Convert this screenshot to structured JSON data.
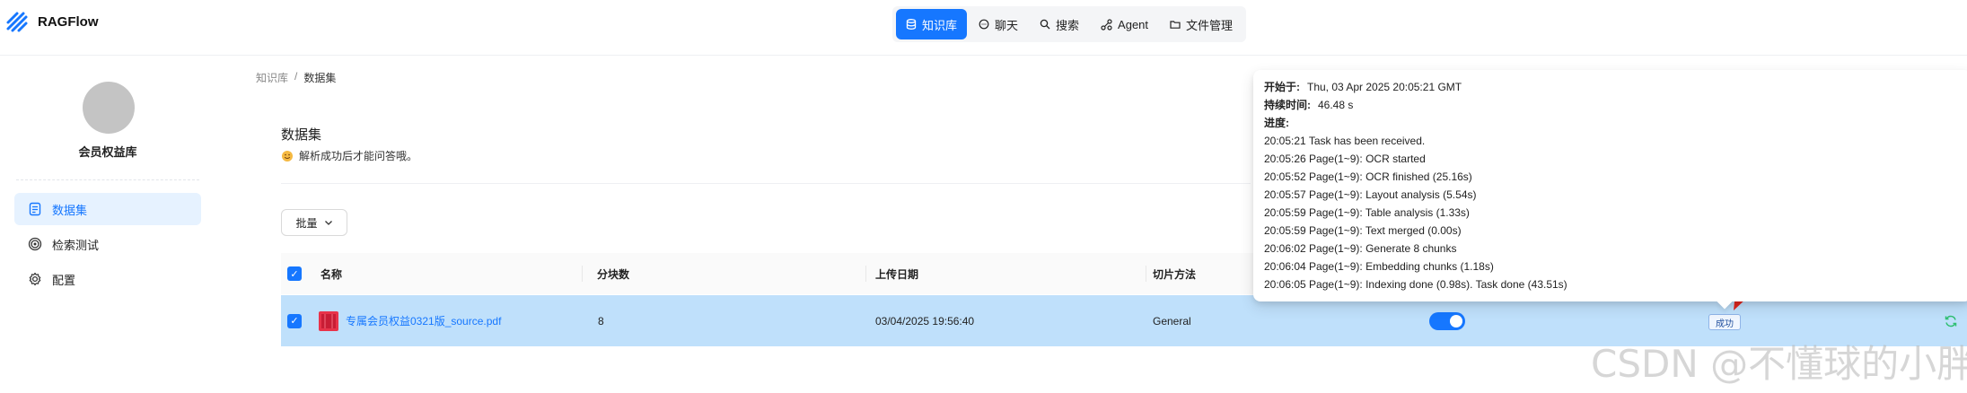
{
  "app": {
    "name": "RAGFlow"
  },
  "nav": [
    {
      "label": "知识库",
      "icon": "database-icon",
      "active": true
    },
    {
      "label": "聊天",
      "icon": "chat-icon",
      "active": false
    },
    {
      "label": "搜索",
      "icon": "search-icon",
      "active": false
    },
    {
      "label": "Agent",
      "icon": "agent-icon",
      "active": false
    },
    {
      "label": "文件管理",
      "icon": "folder-icon",
      "active": false
    }
  ],
  "sidebar": {
    "kb_name": "会员权益库",
    "items": [
      {
        "label": "数据集",
        "icon": "document-icon",
        "active": true
      },
      {
        "label": "检索测试",
        "icon": "target-icon",
        "active": false
      },
      {
        "label": "配置",
        "icon": "gear-icon",
        "active": false
      }
    ]
  },
  "breadcrumb": {
    "root": "知识库",
    "separator": "/",
    "current": "数据集"
  },
  "main": {
    "title": "数据集",
    "description": "解析成功后才能问答哦。",
    "bulk_button": "批量"
  },
  "table": {
    "headers": {
      "name": "名称",
      "chunks": "分块数",
      "upload_date": "上传日期",
      "chunk_method": "切片方法"
    },
    "rows": [
      {
        "name": "专属会员权益0321版_source.pdf",
        "chunks": "8",
        "upload_date": "03/04/2025 19:56:40",
        "chunk_method": "General",
        "enabled": true,
        "status": "成功"
      }
    ]
  },
  "popover": {
    "start_label": "开始于:",
    "start_value": "Thu, 03 Apr 2025 20:05:21 GMT",
    "duration_label": "持续时间:",
    "duration_value": "46.48 s",
    "progress_label": "进度:",
    "progress_lines": [
      "20:05:21 Task has been received.",
      "20:05:26 Page(1~9): OCR started",
      "20:05:52 Page(1~9): OCR finished (25.16s)",
      "20:05:57 Page(1~9): Layout analysis (5.54s)",
      "20:05:59 Page(1~9): Table analysis (1.33s)",
      "20:05:59 Page(1~9): Text merged (0.00s)",
      "20:06:02 Page(1~9): Generate 8 chunks",
      "20:06:04 Page(1~9): Embedding chunks (1.18s)",
      "20:06:05 Page(1~9): Indexing done (0.98s). Task done (43.51s)"
    ]
  },
  "watermark": "CSDN @不懂球的小胖",
  "colors": {
    "primary": "#1677ff",
    "row_selected": "#bfe0fb",
    "annotation_arrow": "#e0261f",
    "refresh": "#2fbf71"
  }
}
